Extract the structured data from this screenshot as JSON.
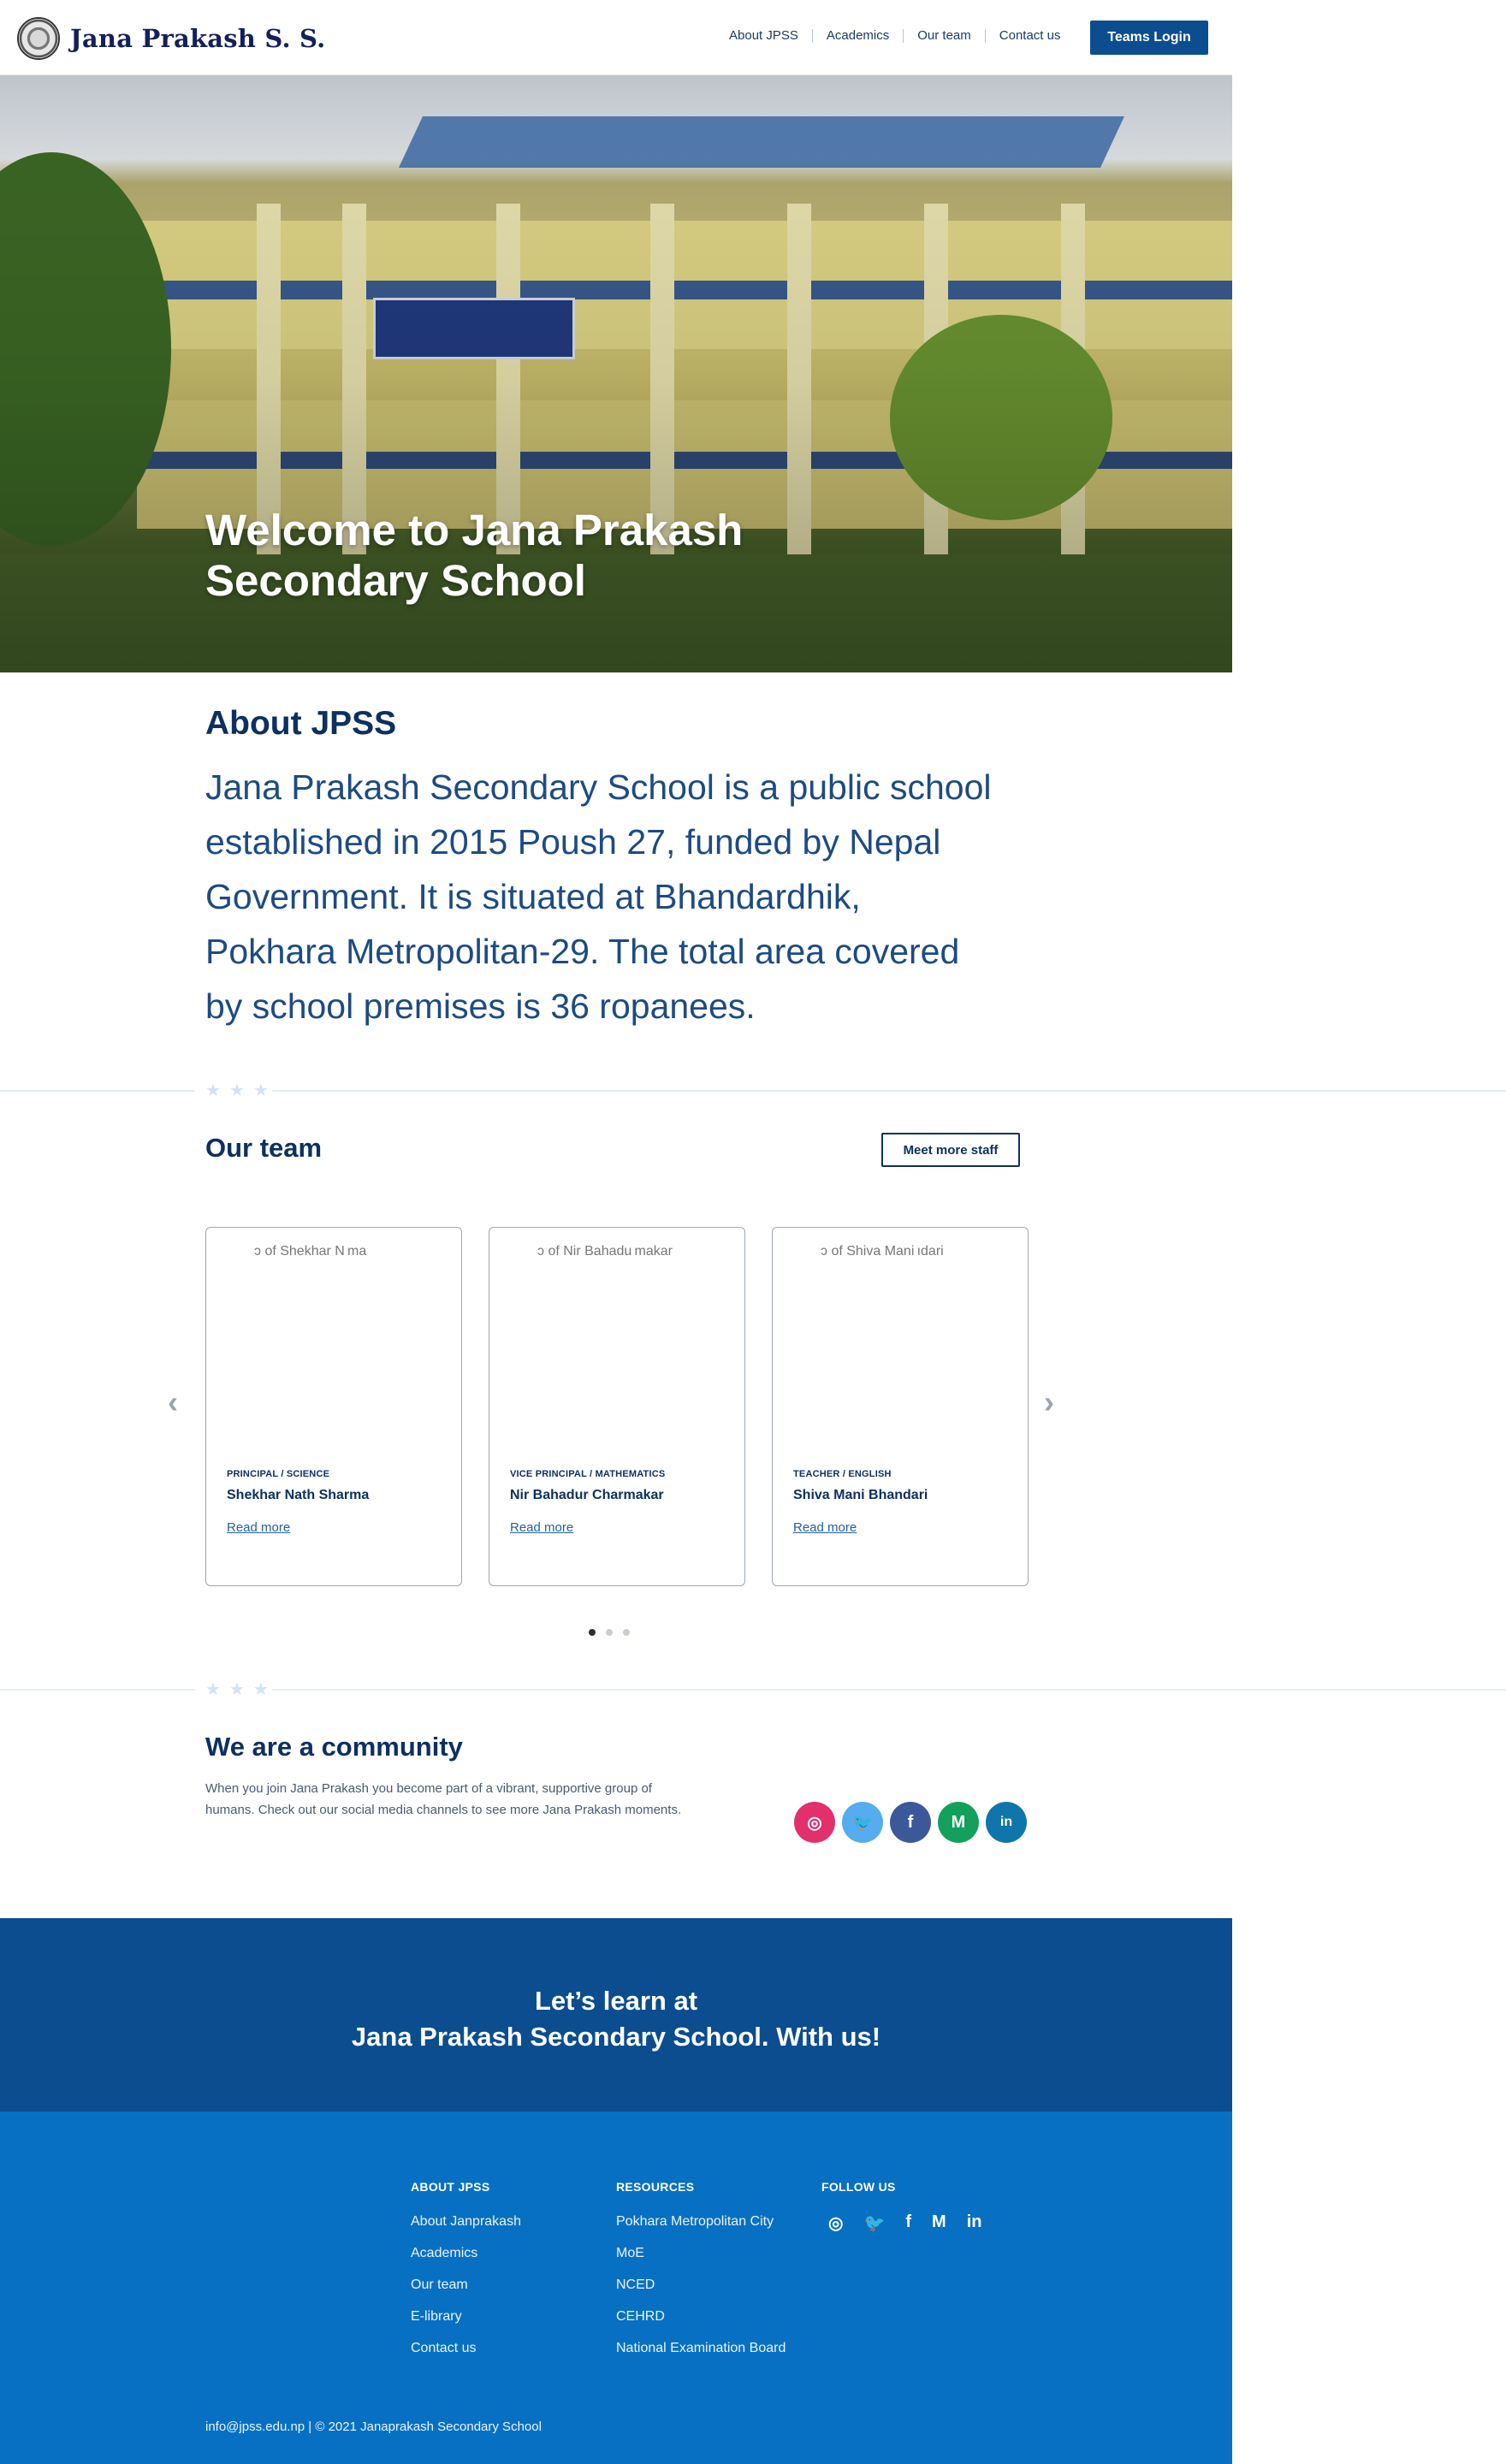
{
  "header": {
    "brand": "Jana Prakash S. S.",
    "nav": [
      "About JPSS",
      "Academics",
      "Our team",
      "Contact us"
    ],
    "login": "Teams Login"
  },
  "hero": {
    "title": "Welcome to Jana Prakash Secondary School"
  },
  "about": {
    "title": "About JPSS",
    "text": "Jana Prakash Secondary School is a public school established in 2015 Poush 27, funded by Nepal Government. It is situated at Bhandardhik, Pokhara Metropolitan-29. The total area covered by school premises is 36 ropanees."
  },
  "team": {
    "title": "Our team",
    "meet_more": "Meet more staff",
    "members": [
      {
        "alt": "ɔ of Shekhar N ma",
        "role": "PRINCIPAL / SCIENCE",
        "name": "Shekhar Nath Sharma",
        "more": "Read more"
      },
      {
        "alt": "ɔ of Nir Bahadu makar",
        "role": "VICE PRINCIPAL / MATHEMATICS",
        "name": "Nir Bahadur Charmakar",
        "more": "Read more"
      },
      {
        "alt": "ɔ of Shiva Mani ıdari",
        "role": "TEACHER / ENGLISH",
        "name": "Shiva Mani Bhandari",
        "more": "Read more"
      }
    ],
    "prev": "‹",
    "next": "›"
  },
  "community": {
    "title": "We are a community",
    "text": "When you join Jana Prakash you become part of a vibrant, supportive group of humans. Check out our social media channels to see more Jana Prakash moments.",
    "socials": [
      {
        "icon": "instagram-icon",
        "glyph": "◎",
        "color": "#e1306c"
      },
      {
        "icon": "twitter-icon",
        "glyph": "🐦",
        "color": "#55acee"
      },
      {
        "icon": "facebook-icon",
        "glyph": "f",
        "color": "#3b5998"
      },
      {
        "icon": "medium-icon",
        "glyph": "M",
        "color": "#12a05a"
      },
      {
        "icon": "linkedin-icon",
        "glyph": "in",
        "color": "#0e76a8"
      }
    ]
  },
  "banner": {
    "line1": "Let’s learn at",
    "line2": "Jana Prakash Secondary School. With us!"
  },
  "footer": {
    "about_heading": "ABOUT JPSS",
    "about_links": [
      "About Janprakash",
      "Academics",
      "Our team",
      "E-library",
      "Contact us"
    ],
    "resources_heading": "RESOURCES",
    "resources_links": [
      "Pokhara Metropolitan City",
      "MoE",
      "NCED",
      "CEHRD",
      "National Examination Board"
    ],
    "follow_heading": "FOLLOW US",
    "follow_icons": [
      "◎",
      "🐦",
      "f",
      "M",
      "in"
    ],
    "copyright": "info@jpss.edu.np   | © 2021 Janaprakash Secondary School"
  }
}
